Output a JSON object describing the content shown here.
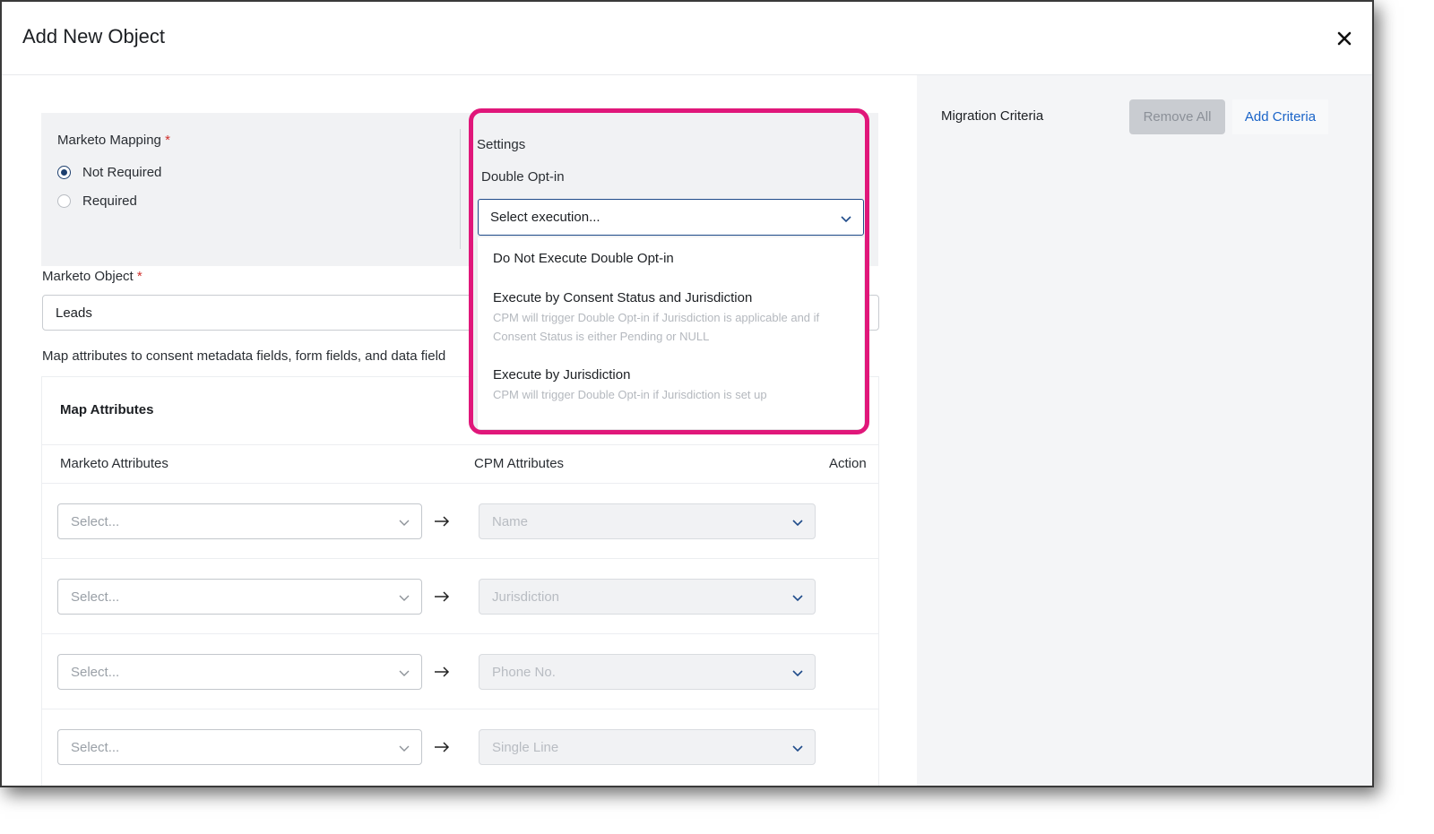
{
  "modal": {
    "title": "Add New Object"
  },
  "criteria": {
    "title": "Migration Criteria",
    "remove_all_label": "Remove All",
    "add_criteria_label": "Add Criteria"
  },
  "mapping": {
    "label": "Marketo Mapping",
    "required_mark": "*",
    "options": [
      {
        "label": "Not Required",
        "selected": true
      },
      {
        "label": "Required",
        "selected": false
      }
    ]
  },
  "marketo_object": {
    "label": "Marketo Object",
    "required_mark": "*",
    "value": "Leads"
  },
  "help_text": "Map attributes to consent metadata fields, form fields, and data field",
  "attributes": {
    "title": "Map Attributes",
    "col_marketo": "Marketo Attributes",
    "col_cpm": "CPM Attributes",
    "col_action": "Action",
    "rows": [
      {
        "left_placeholder": "Select...",
        "right_value": "Name"
      },
      {
        "left_placeholder": "Select...",
        "right_value": "Jurisdiction"
      },
      {
        "left_placeholder": "Select...",
        "right_value": "Phone No."
      },
      {
        "left_placeholder": "Select...",
        "right_value": "Single Line"
      }
    ]
  },
  "settings": {
    "label": "Settings",
    "double_optin_label": "Double Opt-in",
    "select_placeholder": "Select execution...",
    "options": [
      {
        "title": "Do Not Execute Double Opt-in",
        "desc": ""
      },
      {
        "title": "Execute by Consent Status and Jurisdiction",
        "desc": "CPM will trigger Double Opt-in if Jurisdiction is applicable and if Consent Status is either Pending or NULL"
      },
      {
        "title": "Execute by Jurisdiction",
        "desc": "CPM will trigger Double Opt-in if Jurisdiction is set up"
      }
    ]
  },
  "colors": {
    "highlight": "#e0177a",
    "link": "#1a64c8",
    "radio_selected": "#1d3f6e",
    "required": "#d0312d"
  }
}
